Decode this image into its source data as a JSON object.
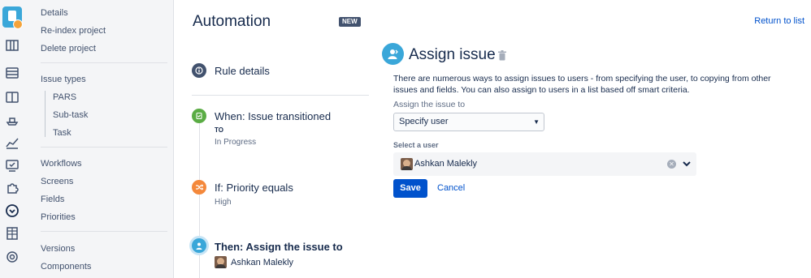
{
  "header": {
    "title": "Automation",
    "badge": "NEW",
    "return_link": "Return to list"
  },
  "rail": {
    "icons": [
      "project-avatar",
      "board-icon",
      "backlog-icon",
      "columns-icon",
      "releases-icon",
      "reports-icon",
      "issues-icon",
      "addons-icon",
      "compass-icon",
      "table-icon",
      "settings-icon"
    ]
  },
  "sidebar": {
    "items_top": [
      "Details",
      "Re-index project",
      "Delete project"
    ],
    "issue_types_header": "Issue types",
    "issue_types": [
      "PARS",
      "Sub-task",
      "Task"
    ],
    "items_mid": [
      "Workflows",
      "Screens",
      "Fields",
      "Priorities"
    ],
    "items_bottom": [
      "Versions",
      "Components"
    ]
  },
  "timeline": {
    "rule_details": "Rule details",
    "trigger": {
      "title": "When: Issue transitioned",
      "key": "TO",
      "value": "In Progress",
      "color": "#5AAC44"
    },
    "condition": {
      "title": "If: Priority equals",
      "value": "High",
      "color": "#F4883B"
    },
    "action": {
      "title": "Then: Assign the issue to",
      "user": "Ashkan Malekly",
      "color": "#3AA7D9"
    }
  },
  "panel": {
    "title": "Assign issue",
    "description": "There are numerous ways to assign issues to users - from specifying the user, to copying from other issues and fields. You can also assign to users in a list based off smart criteria.",
    "assign_label": "Assign the issue to",
    "assign_value": "Specify user",
    "select_user_label": "Select a user",
    "selected_user": "Ashkan Malekly",
    "save_label": "Save",
    "cancel_label": "Cancel"
  }
}
